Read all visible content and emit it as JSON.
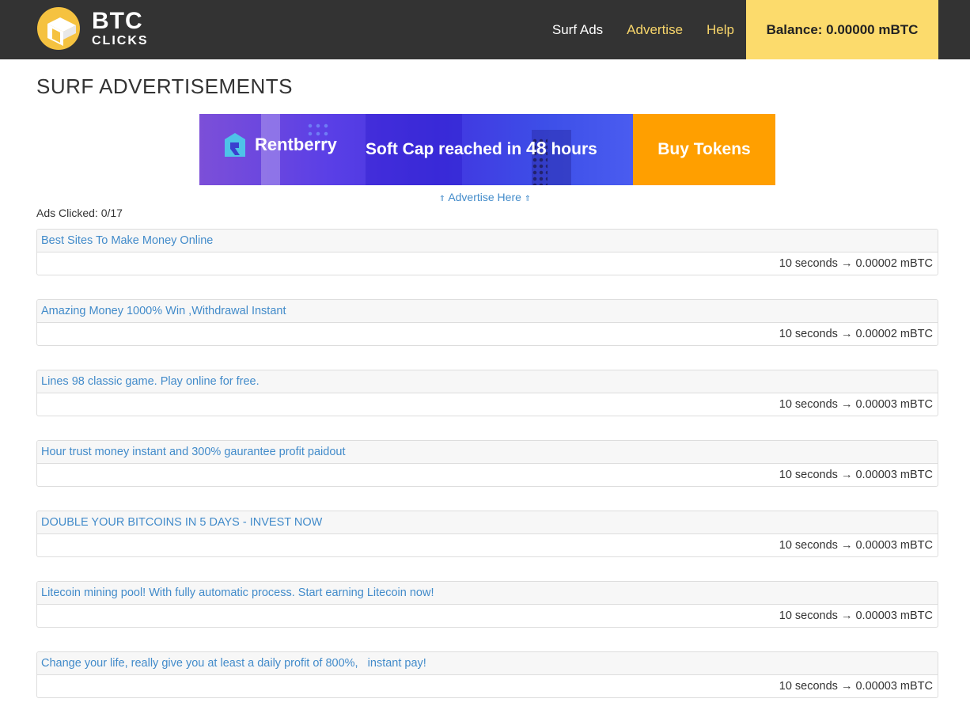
{
  "brand": {
    "name_line1": "BTC",
    "name_line2": "CLICKS",
    "accent_color": "#f5c240",
    "header_bg": "#333333"
  },
  "nav": {
    "surf_ads": "Surf Ads",
    "advertise": "Advertise",
    "help": "Help",
    "balance": "Balance: 0.00000 mBTC"
  },
  "page": {
    "title": "SURF ADVERTISEMENTS",
    "ads_clicked": "Ads Clicked: 0/17"
  },
  "banner": {
    "brand": "Rentberry",
    "headline_prefix": "Soft Cap reached in",
    "headline_number": "48",
    "headline_suffix": "hours",
    "cta": "Buy Tokens",
    "cta_color": "#ff9f00"
  },
  "advertise_here": {
    "arrow_left": "⇑",
    "label": "Advertise Here",
    "arrow_right": "⇑"
  },
  "ads": [
    {
      "title": "Best Sites To Make Money Online",
      "reward": "10 seconds → 0.00002 mBTC"
    },
    {
      "title": "Amazing Money 1000% Win ,Withdrawal Instant",
      "reward": "10 seconds → 0.00002 mBTC"
    },
    {
      "title": "Lines 98 classic game. Play online for free.",
      "reward": "10 seconds → 0.00003 mBTC"
    },
    {
      "title": "Hour trust money instant and 300% gaurantee profit paidout",
      "reward": "10 seconds → 0.00003 mBTC"
    },
    {
      "title": "DOUBLE YOUR BITCOINS IN 5 DAYS - INVEST NOW",
      "reward": "10 seconds → 0.00003 mBTC"
    },
    {
      "title": "Litecoin mining pool! With fully automatic process. Start earning Litecoin now!",
      "reward": "10 seconds → 0.00003 mBTC"
    },
    {
      "title": "Change your life, really give you at least a daily profit of 800%,   instant pay!",
      "reward": "10 seconds → 0.00003 mBTC"
    }
  ]
}
